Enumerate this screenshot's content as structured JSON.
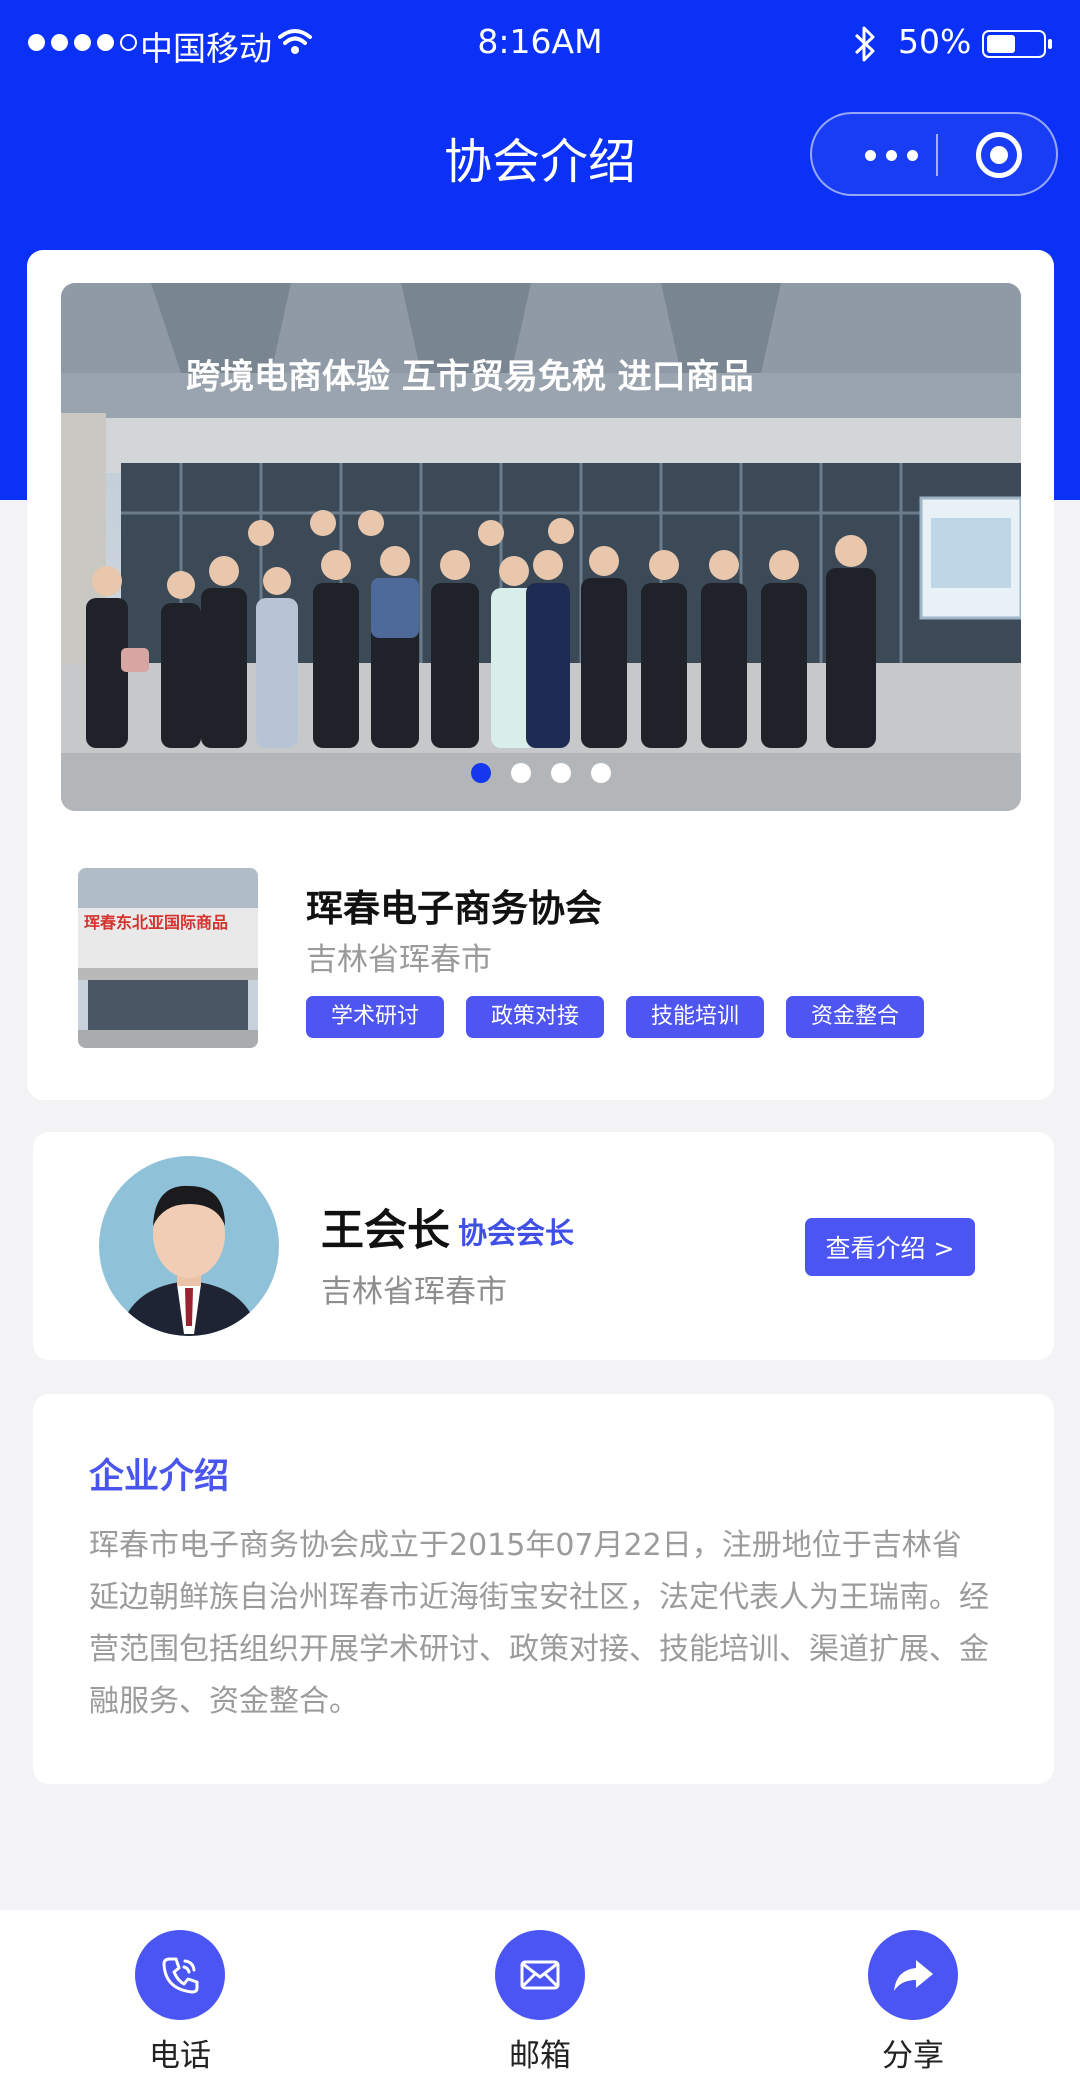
{
  "status_bar": {
    "carrier": "中国移动",
    "time": "8:16AM",
    "battery": "50%"
  },
  "nav": {
    "title": "协会介绍"
  },
  "banner": {
    "sign_text": "跨境电商体验 互市贸易免税 进口商品",
    "slides": 4,
    "active_slide": 1
  },
  "org": {
    "name": "珲春电子商务协会",
    "location": "吉林省珲春市",
    "thumb_sign": "珲春东北亚国际商品",
    "tags": [
      "学术研讨",
      "政策对接",
      "技能培训",
      "资金整合"
    ]
  },
  "president": {
    "name": "王会长",
    "title": "协会会长",
    "location": "吉林省珲春市",
    "button": "查看介绍 >"
  },
  "intro": {
    "title": "企业介绍",
    "text": "珲春市电子商务协会成立于2015年07月22日，注册地位于吉林省延边朝鲜族自治州珲春市近海街宝安社区，法定代表人为王瑞南。经营范围包括组织开展学术研讨、政策对接、技能培训、渠道扩展、金融服务、资金整合。"
  },
  "bottom_bar": {
    "phone": "电话",
    "mail": "邮箱",
    "share": "分享"
  },
  "colors": {
    "primary": "#0a31f5",
    "accent": "#4a55f4"
  },
  "icons": [
    "wifi-icon",
    "bluetooth-icon",
    "more-icon",
    "target-icon",
    "phone-icon",
    "mail-icon",
    "share-icon"
  ]
}
